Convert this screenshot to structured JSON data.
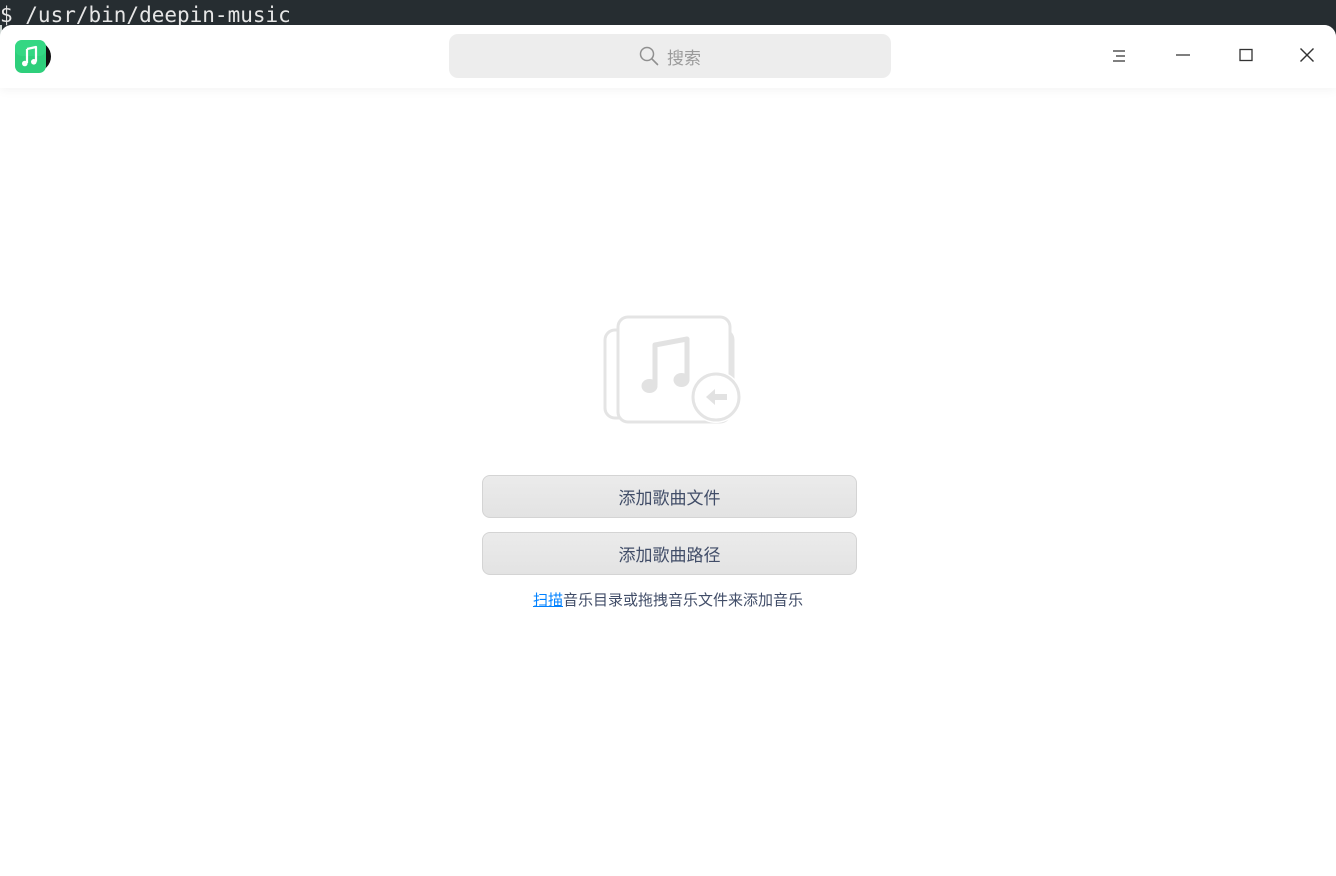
{
  "terminal": {
    "command_line": "$ /usr/bin/deepin-music"
  },
  "titlebar": {
    "app_icon": "deepin-music-icon",
    "search": {
      "placeholder": "搜索",
      "icon": "search-icon"
    },
    "buttons": {
      "menu_icon": "menu-icon",
      "minimize_icon": "minimize-icon",
      "maximize_icon": "maximize-icon",
      "close_icon": "close-icon"
    }
  },
  "empty_state": {
    "illustration_icon": "music-import-icon",
    "add_files_label": "添加歌曲文件",
    "add_folder_label": "添加歌曲路径",
    "hint": {
      "link_text": "扫描",
      "rest_text": "音乐目录或拖拽音乐文件来添加音乐"
    }
  },
  "colors": {
    "accent": "#0081ff",
    "button_text": "#414d68",
    "search_bg": "#ededed",
    "logo_green": "#2fd67a"
  }
}
